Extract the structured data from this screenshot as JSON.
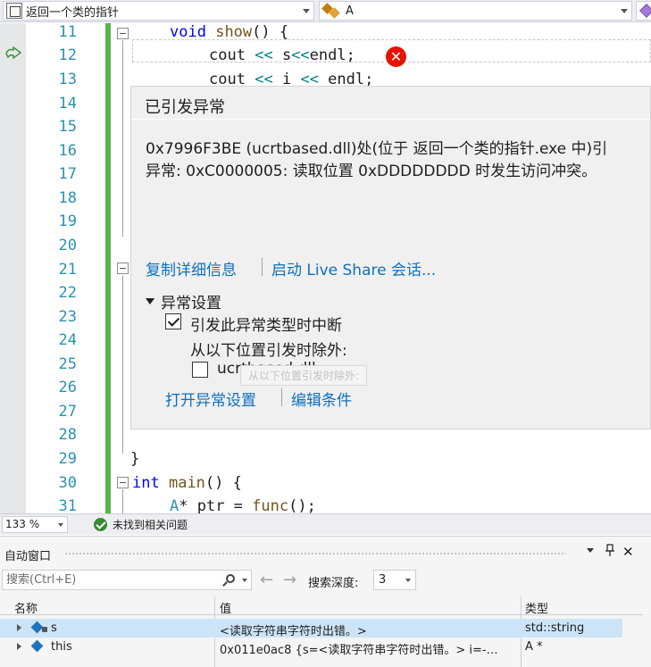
{
  "navbar": {
    "scope_combo": "返回一个类的指针",
    "member_combo": "A"
  },
  "editor": {
    "line_numbers": [
      "11",
      "12",
      "13",
      "14",
      "15",
      "16",
      "17",
      "18",
      "19",
      "20",
      "21",
      "22",
      "23",
      "24",
      "25",
      "26",
      "27",
      "28",
      "29",
      "30",
      "31"
    ],
    "code": {
      "l11_kw": "void",
      "l11_fn": "show",
      "l11_rest": "() {",
      "l12_a": "cout",
      "l12_op1": "<<",
      "l12_b": "s",
      "l12_op2": "<<",
      "l12_c": "endl;",
      "l13_a": "cout",
      "l13_op1": "<<",
      "l13_b": "i",
      "l13_op2": "<<",
      "l13_c": "endl;",
      "l29": "}",
      "l30_kw": "int",
      "l30_fn": "main",
      "l30_rest": "() {",
      "l31_ty": "A",
      "l31_rest": "* ptr = ",
      "l31_fn": "func",
      "l31_end": "();"
    }
  },
  "exception": {
    "title": "已引发异常",
    "line1": "0x7996F3BE (ucrtbased.dll)处(位于 返回一个类的指针.exe 中)引",
    "line2": "异常: 0xC0000005: 读取位置 0xDDDDDDDD 时发生访问冲突。",
    "copy_details": "复制详细信息",
    "live_share": "启动 Live Share 会话...",
    "settings_title": "异常设置",
    "break_option": "引发此异常类型时中断",
    "except_label": "从以下位置引发时除外:",
    "dll_option": "ucrtbased.dll",
    "ghost_tooltip": "从以下位置引发时除外:",
    "open_settings": "打开异常设置",
    "edit_conditions": "编辑条件"
  },
  "statusbar": {
    "zoom": "133 %",
    "issues": "未找到相关问题"
  },
  "autos": {
    "title": "自动窗口",
    "pin": "⊓",
    "close": "✕",
    "search_placeholder": "搜索(Ctrl+E)",
    "depth_label": "搜索深度:",
    "depth_value": "3",
    "columns": [
      "名称",
      "值",
      "类型"
    ],
    "rows": [
      {
        "name": "s",
        "value": "<读取字符串字符时出错。>",
        "type": "std::string"
      },
      {
        "name": "this",
        "value": "0x011e0ac8 {s=<读取字符串字符时出错。> i=-…",
        "type": "A *"
      }
    ]
  }
}
